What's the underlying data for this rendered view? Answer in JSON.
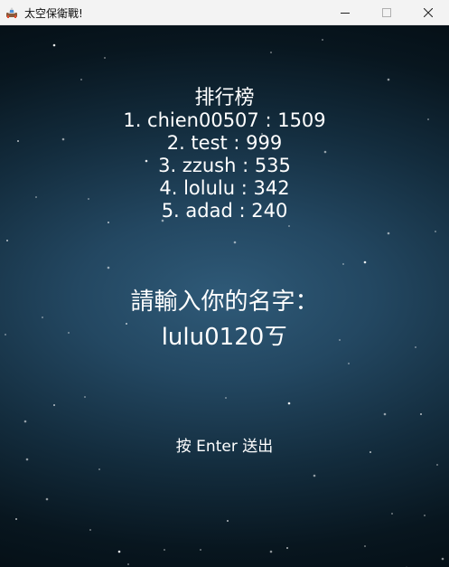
{
  "window": {
    "title": "太空保衛戰!"
  },
  "leaderboard": {
    "title": "排行榜",
    "entries": [
      "1. chien00507 : 1509",
      "2. test : 999",
      "3. zzush : 535",
      "4. lolulu : 342",
      "5. adad : 240"
    ]
  },
  "name_entry": {
    "prompt": "請輸入你的名字：",
    "value": "lulu0120ㄎ"
  },
  "hint": "按 Enter 送出",
  "colors": {
    "text": "#ffffff",
    "background_center": "#2f5a78",
    "background_edge": "#051017",
    "titlebar": "#f3f3f3"
  },
  "icons": {
    "app": "spaceship-icon",
    "minimize": "minimize-icon",
    "maximize": "maximize-icon",
    "close": "close-icon"
  }
}
